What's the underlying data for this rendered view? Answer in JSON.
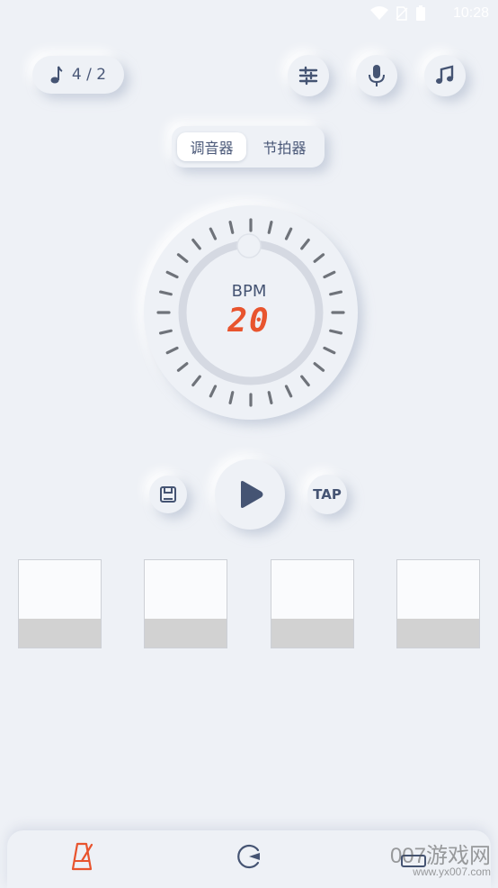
{
  "status_bar": {
    "time": "10:28"
  },
  "top_bar": {
    "time_signature": "4 / 2",
    "icons": [
      "note-icon",
      "sliders-icon",
      "microphone-icon",
      "music-notes-icon"
    ]
  },
  "mode_tabs": [
    {
      "label": "调音器",
      "active": true
    },
    {
      "label": "节拍器",
      "active": false
    }
  ],
  "dial": {
    "label": "BPM",
    "value": "20"
  },
  "controls": {
    "tap_label": "TAP"
  },
  "beats": [
    {
      "level": 0.33
    },
    {
      "level": 0.33
    },
    {
      "level": 0.33
    },
    {
      "level": 0.33
    }
  ],
  "bottom_nav": {
    "items": [
      "metronome-tab",
      "tuner-tab",
      "more-tab"
    ],
    "active_color": "#e8542e"
  },
  "watermark": {
    "line1": "007游戏网",
    "line2": "www.yx007.com"
  },
  "colors": {
    "accent": "#e8542e",
    "icon": "#455473",
    "background": "#eef1f6"
  }
}
